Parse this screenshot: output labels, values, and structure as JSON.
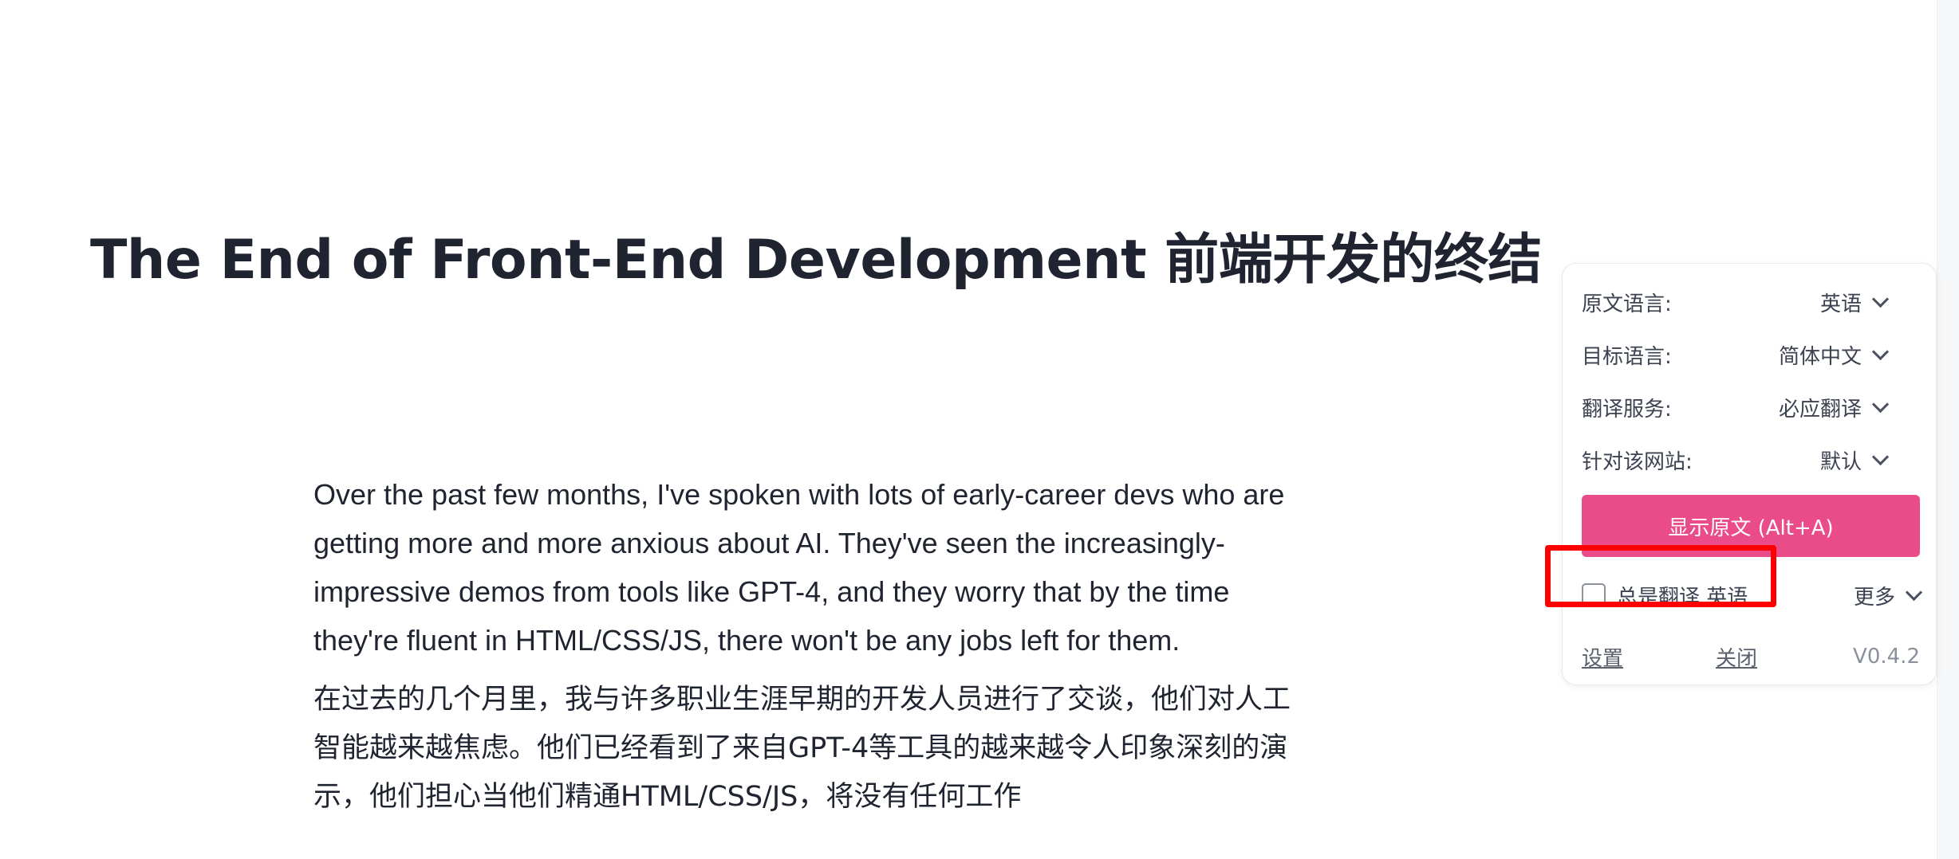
{
  "article": {
    "title": "The End of Front-End Development 前端开发的终结",
    "para_en": "Over the past few months, I've spoken with lots of early-career devs who are getting more and more anxious about AI. They've seen the increasingly-impressive demos from tools like GPT-4, and they worry that by the time they're fluent in HTML/CSS/JS, there won't be any jobs left for them.",
    "para_zh": "在过去的几个月里，我与许多职业生涯早期的开发人员进行了交谈，他们对人工智能越来越焦虑。他们已经看到了来自GPT-4等工具的越来越令人印象深刻的演示，他们担心当他们精通HTML/CSS/JS，将没有任何工作"
  },
  "panel": {
    "rows": [
      {
        "label": "原文语言:",
        "value": "英语"
      },
      {
        "label": "目标语言:",
        "value": "简体中文"
      },
      {
        "label": "翻译服务:",
        "value": "必应翻译"
      },
      {
        "label": "针对该网站:",
        "value": "默认"
      }
    ],
    "show_original_label": "显示原文 (Alt+A)",
    "always_translate_label": "总是翻译 英语",
    "always_translate_checked": false,
    "more_label": "更多",
    "settings_link": "设置",
    "close_link": "关闭",
    "version": "V0.4.2"
  },
  "colors": {
    "accent": "#ea4c89",
    "highlight": "#ff0000",
    "text": "#1f2430"
  }
}
